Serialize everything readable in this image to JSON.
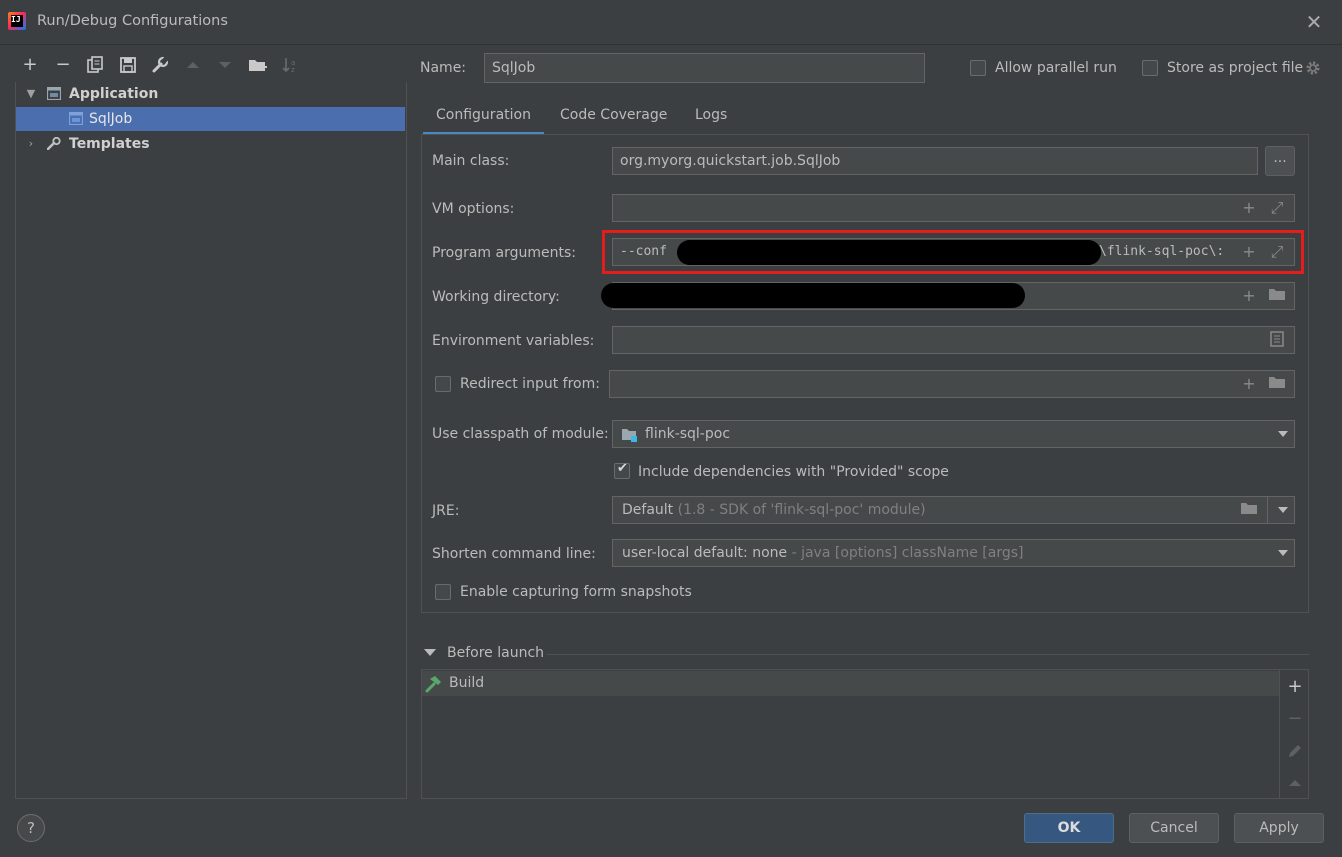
{
  "window": {
    "title": "Run/Debug Configurations"
  },
  "toolbar": {
    "add": "+",
    "remove": "−"
  },
  "tree": {
    "application_label": "Application",
    "sqljob_label": "SqlJob",
    "templates_label": "Templates"
  },
  "header": {
    "name_label": "Name:",
    "name_value": "SqlJob",
    "allow_parallel_label": "Allow parallel run",
    "store_project_label": "Store as project file"
  },
  "tabs": [
    {
      "label": "Configuration"
    },
    {
      "label": "Code Coverage"
    },
    {
      "label": "Logs"
    }
  ],
  "form": {
    "main_class_label": "Main class:",
    "main_class_value": "org.myorg.quickstart.job.SqlJob",
    "browse_label": "...",
    "vm_options_label": "VM options:",
    "vm_options_value": "",
    "program_args_label": "Program arguments:",
    "program_args_prefix": "--conf",
    "program_args_suffix": "\\flink-sql-poc\\:",
    "working_dir_label": "Working directory:",
    "env_vars_label": "Environment variables:",
    "redirect_label": "Redirect input from:",
    "classpath_label": "Use classpath of module:",
    "classpath_value": "flink-sql-poc",
    "include_deps_label": "Include dependencies with \"Provided\" scope",
    "jre_label": "JRE:",
    "jre_value": "Default",
    "jre_hint": "(1.8 - SDK of 'flink-sql-poc' module)",
    "shorten_label": "Shorten command line:",
    "shorten_value": "user-local default: none",
    "shorten_hint": "- java [options] className [args]",
    "snapshots_label": "Enable capturing form snapshots"
  },
  "before_launch": {
    "label": "Before launch",
    "build_label": "Build"
  },
  "buttons": {
    "ok": "OK",
    "cancel": "Cancel",
    "apply": "Apply",
    "help": "?"
  },
  "colors": {
    "background": "#3c3f41",
    "selection": "#4b6eaf",
    "highlight_box": "#e41c1c",
    "primary_button": "#365880"
  }
}
